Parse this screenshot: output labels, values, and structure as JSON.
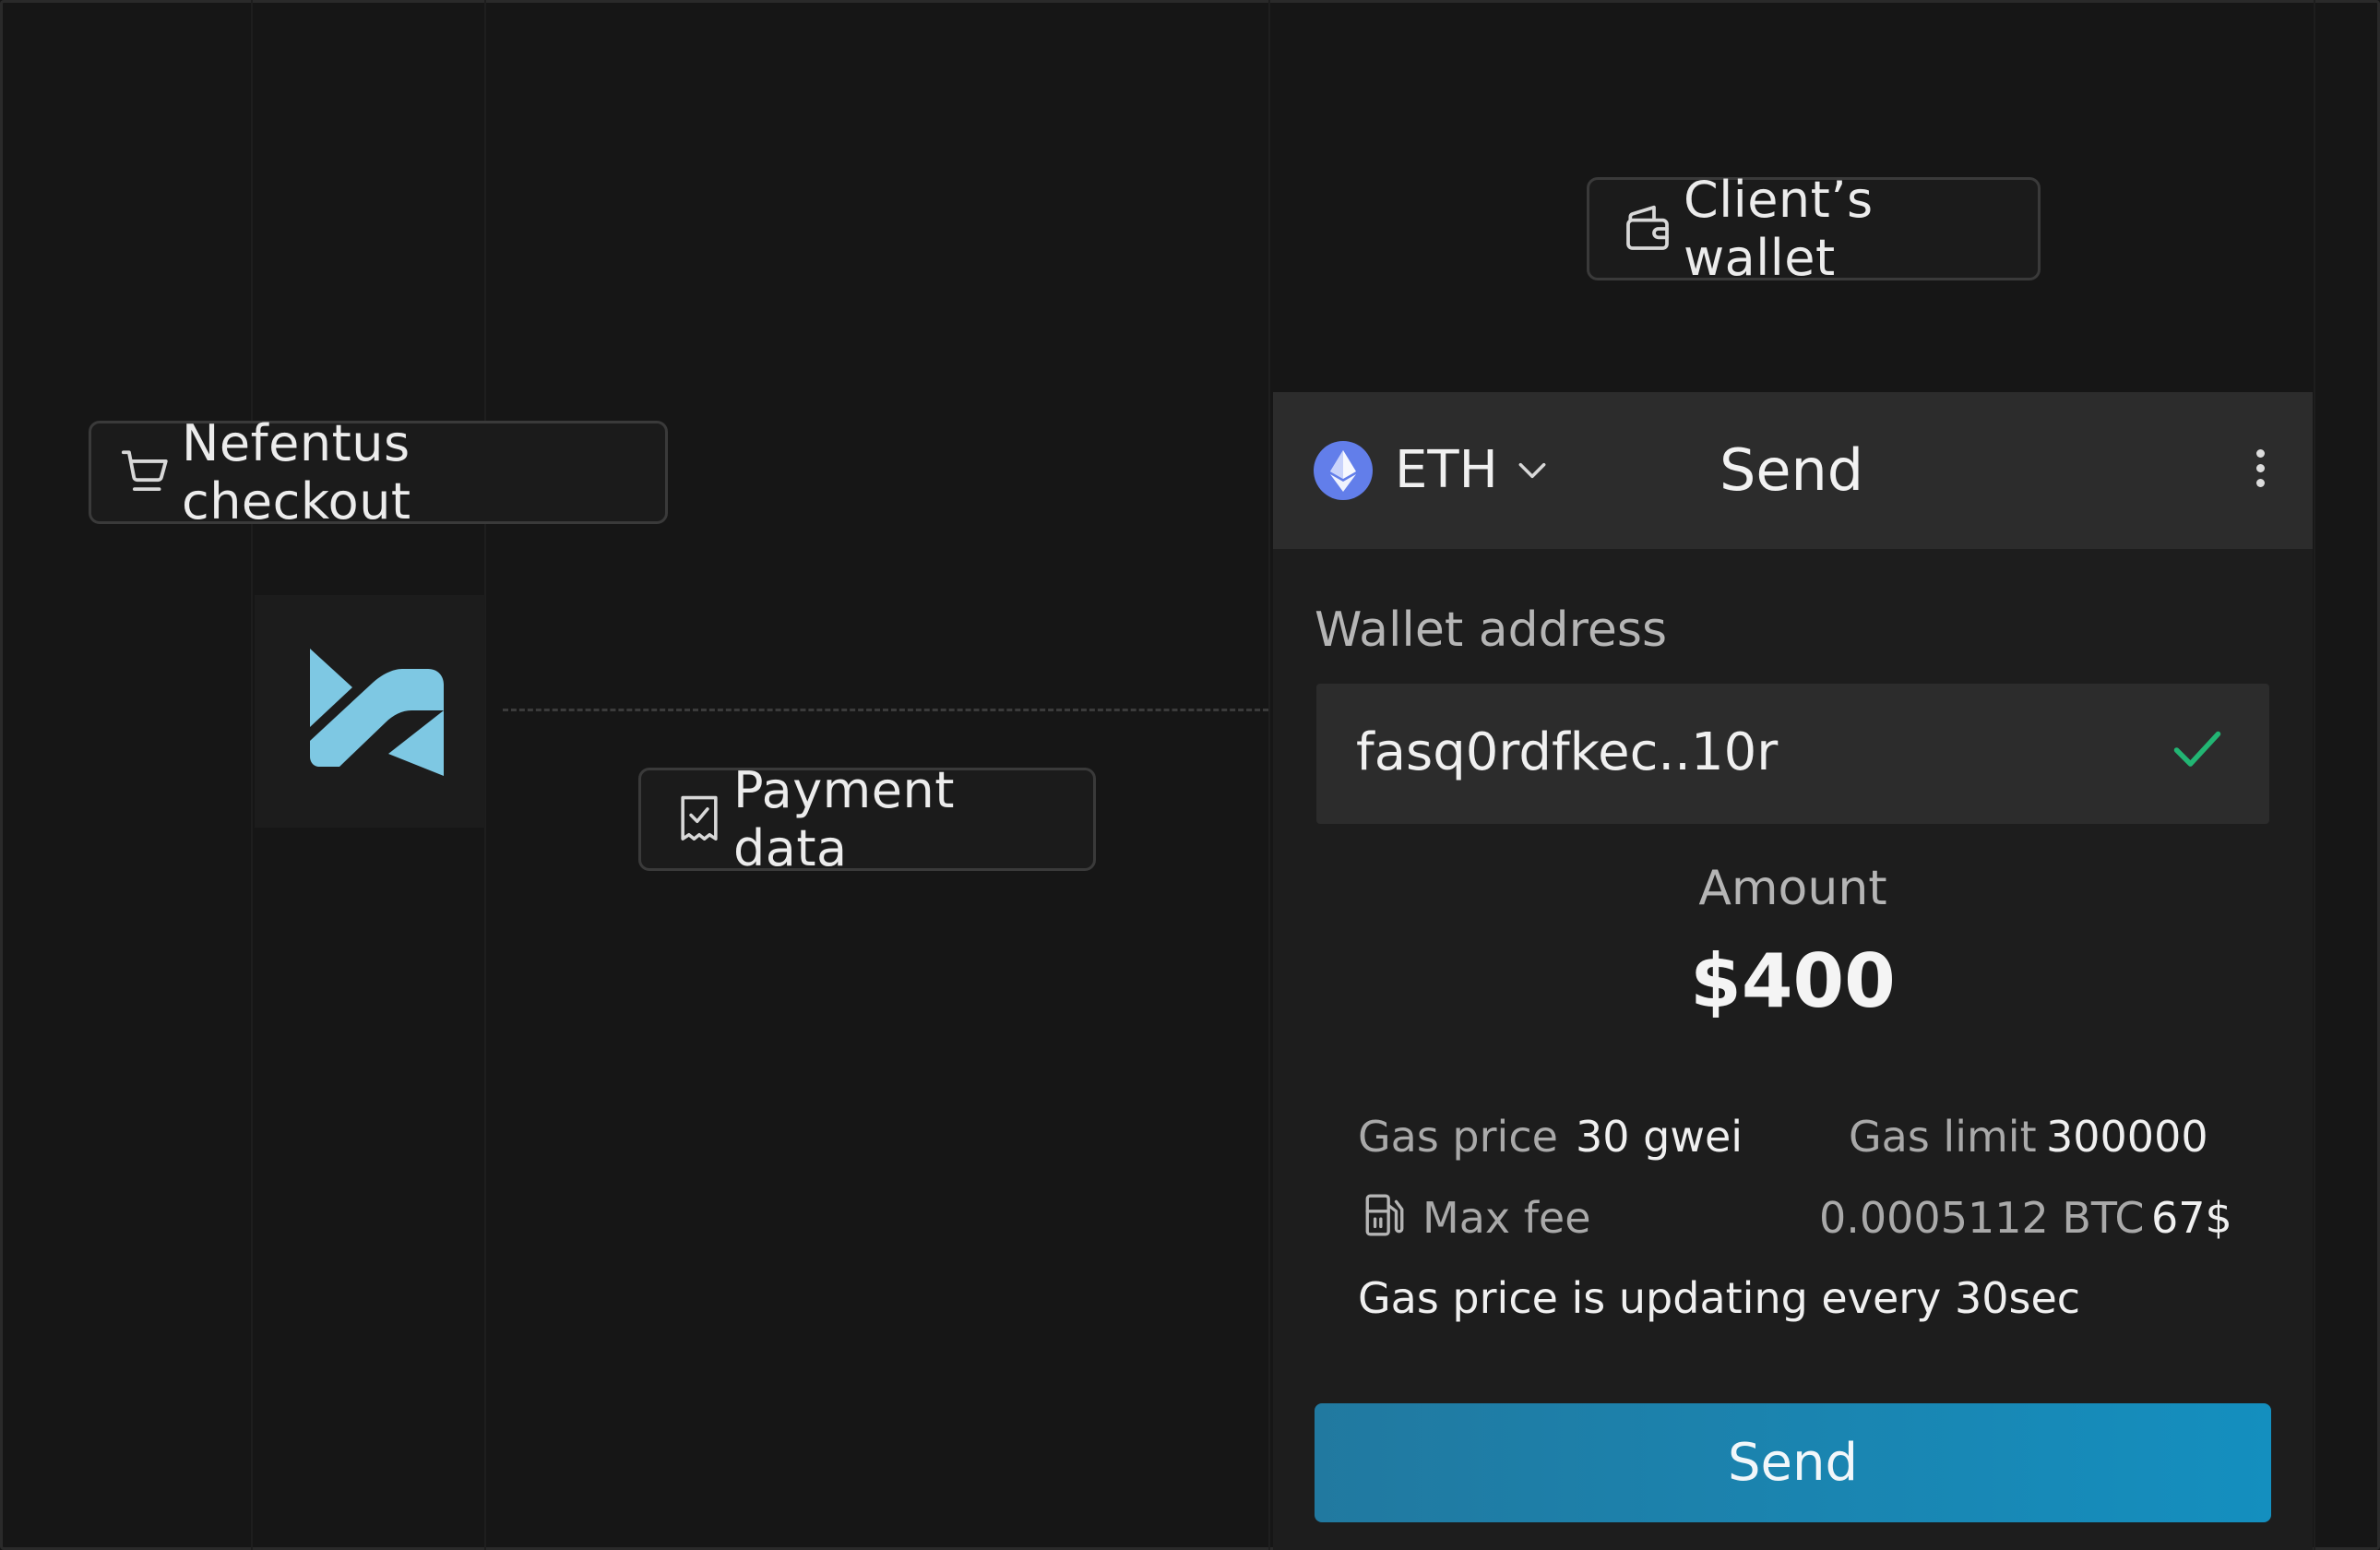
{
  "labels": {
    "checkout": "Nefentus checkout",
    "payment_data": "Payment data",
    "client_wallet": "Client’s wallet"
  },
  "wallet_panel": {
    "currency": "ETH",
    "title": "Send",
    "wallet_address_label": "Wallet address",
    "wallet_address_value": "fasq0rdfkec..10r",
    "amount_label": "Amount",
    "amount_value": "$400",
    "gas_price_label": "Gas price",
    "gas_price_value": "30 gwei",
    "gas_limit_label": "Gas limit",
    "gas_limit_value": "300000",
    "max_fee_label": "Max fee",
    "max_fee_crypto": "0.0005112 BTC",
    "max_fee_fiat": "67$",
    "gas_note": "Gas price is updating every 30sec",
    "send_button": "Send"
  },
  "icons": {
    "cart": "cart-icon",
    "receipt": "receipt-check-icon",
    "wallet": "wallet-icon",
    "eth": "ethereum-icon",
    "chevron": "chevron-down-icon",
    "menu": "more-vertical-icon",
    "check": "check-icon",
    "fuel": "fuel-pump-icon",
    "logo": "nefentus-logo"
  },
  "colors": {
    "background": "#161616",
    "logo": "#7ec8e3",
    "eth": "#627eea",
    "check": "#22b573",
    "send_button": "#1a8ab8"
  }
}
